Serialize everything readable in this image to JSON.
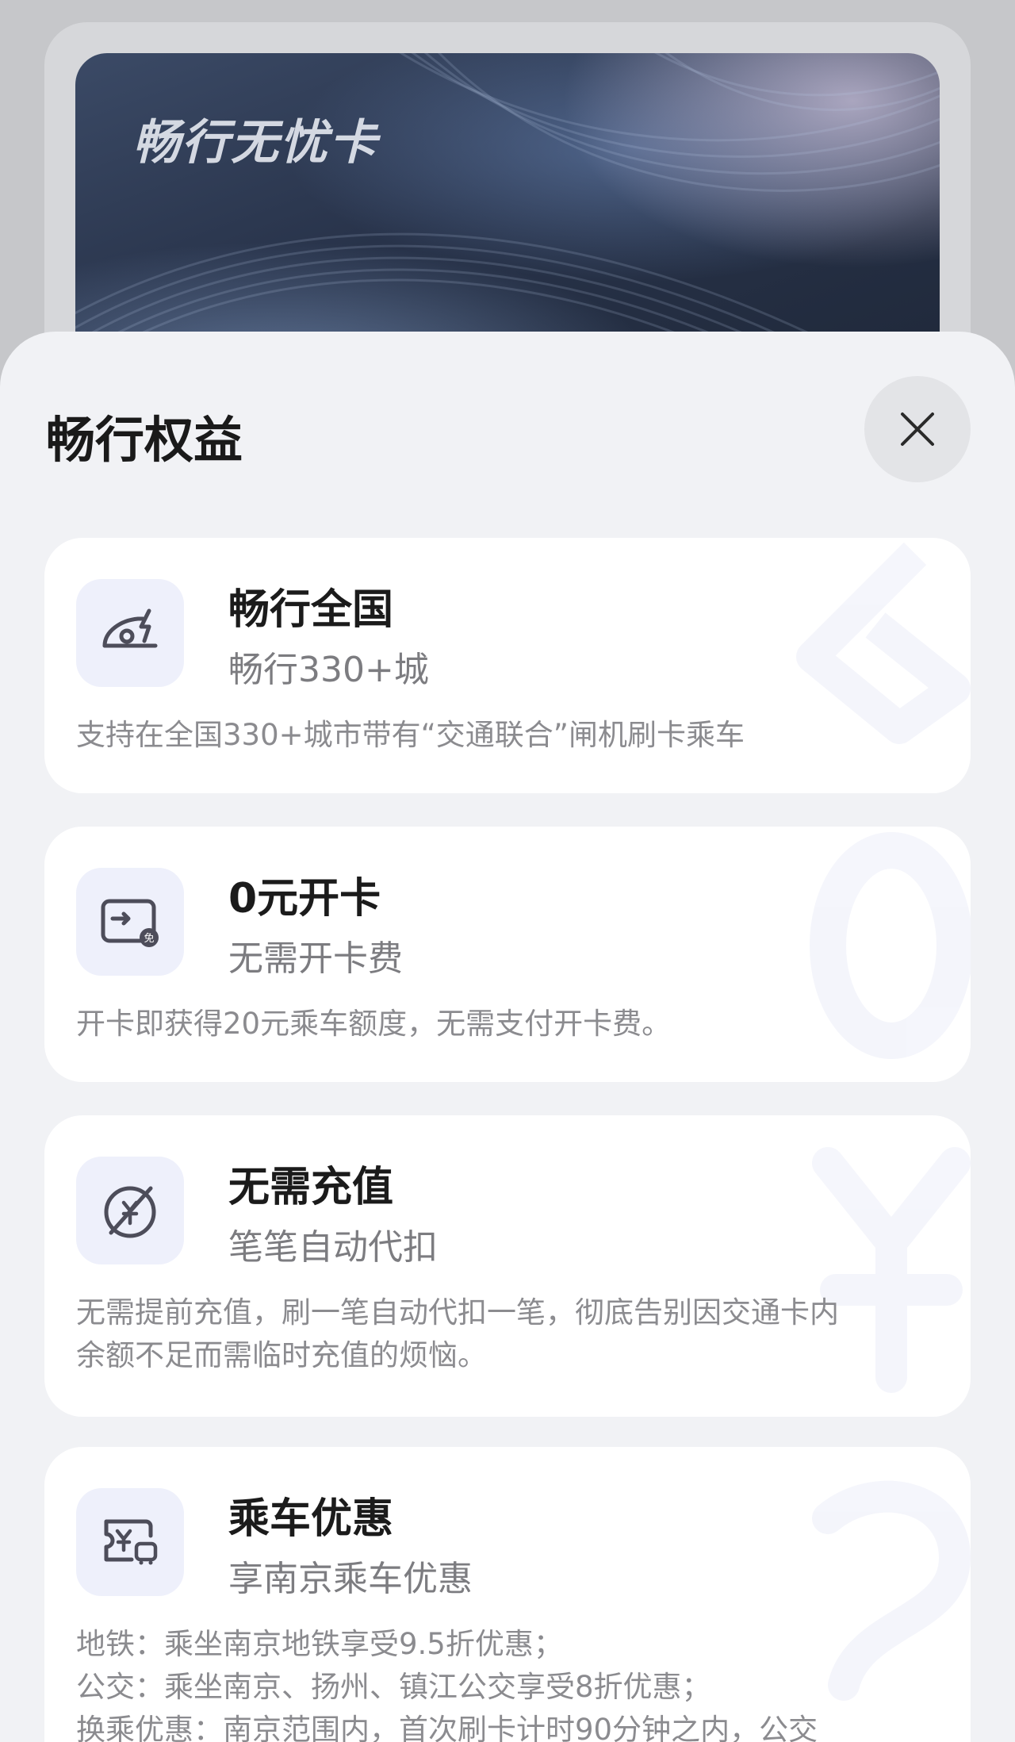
{
  "card": {
    "title": "畅行无忧卡"
  },
  "sheet": {
    "title": "畅行权益",
    "close_label": "关闭"
  },
  "benefits": [
    {
      "icon": "train-lightning-icon",
      "title": "畅行全国",
      "subtitle": "畅行330+城",
      "desc": [
        "支持在全国330+城市带有“交通联合”闸机刷卡乘车"
      ]
    },
    {
      "icon": "free-card-icon",
      "title": "0元开卡",
      "subtitle": "无需开卡费",
      "desc": [
        "开卡即获得20元乘车额度，无需支付开卡费。"
      ]
    },
    {
      "icon": "no-recharge-yen-icon",
      "title": "无需充值",
      "subtitle": "笔笔自动代扣",
      "desc": [
        "无需提前充值，刷一笔自动代扣一笔，彻底告别因交通卡内",
        "余额不足而需临时充值的烦恼。"
      ]
    },
    {
      "icon": "ride-discount-ticket-icon",
      "title": "乘车优惠",
      "subtitle": "享南京乘车优惠",
      "desc": [
        "地铁：乘坐南京地铁享受9.5折优惠；",
        "公交：乘坐南京、扬州、镇江公交享受8折优惠；",
        "换乘优惠：南京范围内，首次刷卡计时90分钟之内，公交"
      ]
    }
  ]
}
